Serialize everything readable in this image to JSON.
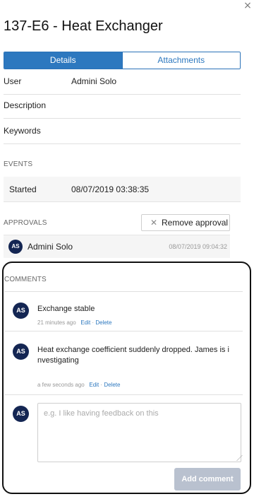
{
  "header": {
    "title": "137-E6 - Heat Exchanger",
    "close_glyph": "×"
  },
  "tabs": [
    {
      "label": "Details",
      "active": true
    },
    {
      "label": "Attachments",
      "active": false
    }
  ],
  "details": {
    "fields": [
      {
        "label": "User",
        "value": "Admini Solo"
      },
      {
        "label": "Description",
        "value": ""
      },
      {
        "label": "Keywords",
        "value": ""
      }
    ]
  },
  "events": {
    "section_label": "EVENTS",
    "items": [
      {
        "label": "Started",
        "value": "08/07/2019 03:38:35"
      }
    ]
  },
  "approvals": {
    "section_label": "APPROVALS",
    "remove_button_label": "Remove approval",
    "items": [
      {
        "initials": "AS",
        "name": "Admini Solo",
        "date": "08/07/2019 09:04:32"
      }
    ]
  },
  "comments": {
    "section_label": "COMMENTS",
    "items": [
      {
        "initials": "AS",
        "text": "Exchange stable",
        "time": "21 minutes ago",
        "edit_label": "Edit",
        "separator": "·",
        "delete_label": "Delete"
      },
      {
        "initials": "AS",
        "text": "Heat exchange coefficient suddenly dropped. James is i nvestigating",
        "time": "a few seconds ago",
        "edit_label": "Edit",
        "separator": "·",
        "delete_label": "Delete"
      }
    ],
    "new_comment": {
      "initials": "AS",
      "placeholder": "e.g. I like having feedback on this",
      "submit_label": "Add comment"
    }
  },
  "colors": {
    "accent": "#2d78bf",
    "avatar_bg": "#142653",
    "button_disabled": "#b9c1cf"
  }
}
